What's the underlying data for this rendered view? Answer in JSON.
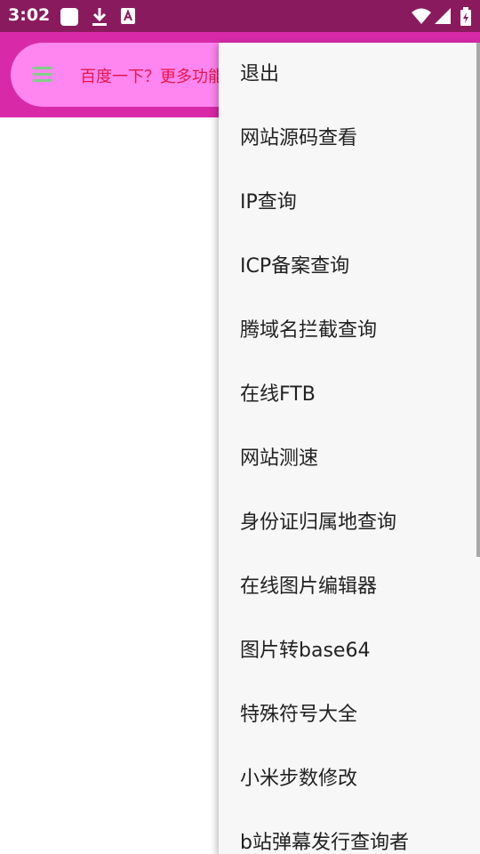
{
  "status_bar": {
    "time": "3:02",
    "left_icons": [
      "app-notification-icon",
      "download-icon",
      "font-a-icon"
    ],
    "right_icons": [
      "wifi-icon",
      "signal-icon",
      "battery-charging-icon"
    ]
  },
  "app_bar": {
    "menu_icon": "hamburger-menu-icon",
    "search_text": "百度一下？更多功能"
  },
  "popup_menu": {
    "items": [
      "退出",
      "网站源码查看",
      "IP查询",
      "ICP备案查询",
      "腾域名拦截查询",
      "在线FTB",
      "网站测速",
      "身份证归属地查询",
      "在线图片编辑器",
      "图片转base64",
      "特殊符号大全",
      "小米步数修改",
      "b站弹幕发行查询者"
    ]
  },
  "colors": {
    "status_bar": "#8a1a5e",
    "app_bar": "#d82aa8",
    "search_pill": "#ff86f0",
    "search_text": "#e8174a",
    "menu_icon": "#7fcf88",
    "menu_bg": "#f7f7f8"
  }
}
